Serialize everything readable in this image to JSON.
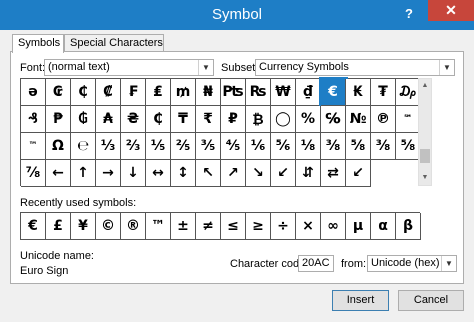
{
  "window": {
    "title": "Symbol",
    "help_label": "?",
    "close_label": "✕"
  },
  "tabs": [
    {
      "label": "Symbols",
      "active": true
    },
    {
      "label": "Special Characters",
      "active": false
    }
  ],
  "font": {
    "label": "Font:",
    "value": "(normal text)"
  },
  "subset": {
    "label": "Subset:",
    "value": "Currency Symbols"
  },
  "symbols": [
    "ə",
    "₢",
    "₵",
    "₡",
    "₣",
    "₤",
    "₥",
    "₦",
    "₧",
    "₨",
    "₩",
    "₫",
    "€",
    "₭",
    "₮",
    "₯",
    "₰",
    "₱",
    "₲",
    "₳",
    "₴",
    "₵",
    "₸",
    "₹",
    "₽",
    "₿",
    "◯",
    "%",
    "℅",
    "№",
    "℗",
    "℠",
    "™",
    "Ω",
    "℮",
    "⅓",
    "⅔",
    "⅕",
    "⅖",
    "⅗",
    "⅘",
    "⅙",
    "⅚",
    "⅛",
    "⅜",
    "⅝",
    "⅜",
    "⅝",
    "⅞",
    "←",
    "↑",
    "→",
    "↓",
    "↔",
    "↕",
    "↖",
    "↗",
    "↘",
    "↙",
    "⇵",
    "⇄",
    "↙"
  ],
  "selected_index": 12,
  "recent": {
    "label": "Recently used symbols:",
    "items": [
      "€",
      "£",
      "¥",
      "©",
      "®",
      "™",
      "±",
      "≠",
      "≤",
      "≥",
      "÷",
      "×",
      "∞",
      "µ",
      "α",
      "β"
    ]
  },
  "unicode_name": {
    "label": "Unicode name:",
    "value": "Euro Sign"
  },
  "character_code": {
    "label": "Character code:",
    "value": "20AC"
  },
  "from": {
    "label": "from:",
    "value": "Unicode (hex)"
  },
  "buttons": {
    "insert": "Insert",
    "cancel": "Cancel"
  }
}
